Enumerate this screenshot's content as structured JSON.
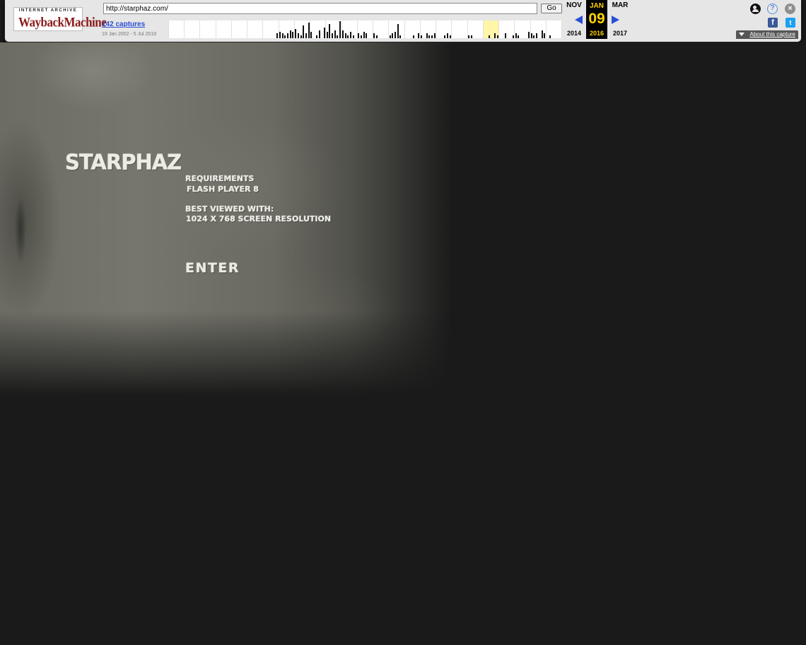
{
  "wayback": {
    "logo_top": "INTERNET ARCHIVE",
    "logo_bottom": "WaybackMachine",
    "url": "http://starphaz.com/",
    "go_label": "Go",
    "captures_label": "142 captures",
    "date_range": "19 Jan 2002 - 5 Jul 2019",
    "prev_month": "NOV",
    "prev_year": "2014",
    "current_month": "JAN",
    "current_day": "09",
    "current_year": "2016",
    "next_month": "MAR",
    "next_year": "2017",
    "about_label": "About this capture",
    "facebook_glyph": "f",
    "twitter_glyph": "t",
    "help_glyph": "?",
    "close_glyph": "×"
  },
  "sparkline": {
    "years": 18,
    "current_year_index": 20,
    "bars": [
      [
        6,
        2
      ],
      [
        6,
        3
      ],
      [
        7,
        2
      ],
      [
        7,
        4
      ],
      [
        8,
        3
      ],
      [
        9,
        2
      ],
      [
        10,
        3
      ],
      [
        11,
        5
      ],
      [
        12,
        4
      ],
      [
        13,
        6
      ],
      [
        14,
        3
      ],
      [
        15,
        2
      ],
      [
        16,
        8
      ],
      [
        17,
        3
      ],
      [
        18,
        10
      ],
      [
        19,
        4
      ],
      [
        21,
        2
      ],
      [
        22,
        5
      ],
      [
        24,
        7
      ],
      [
        25,
        4
      ],
      [
        26,
        9
      ],
      [
        27,
        3
      ],
      [
        28,
        5
      ],
      [
        29,
        2
      ],
      [
        30,
        11
      ],
      [
        31,
        5
      ],
      [
        32,
        3
      ],
      [
        33,
        2
      ],
      [
        34,
        4
      ],
      [
        35,
        2
      ],
      [
        37,
        3
      ],
      [
        38,
        2
      ],
      [
        39,
        4
      ],
      [
        40,
        3
      ],
      [
        43,
        3
      ],
      [
        44,
        2
      ],
      [
        49,
        2
      ],
      [
        50,
        3
      ],
      [
        51,
        4
      ],
      [
        52,
        9
      ],
      [
        53,
        2
      ],
      [
        58,
        2
      ],
      [
        60,
        3
      ],
      [
        61,
        2
      ],
      [
        63,
        3
      ],
      [
        64,
        2
      ],
      [
        65,
        2
      ],
      [
        66,
        3
      ],
      [
        70,
        2
      ],
      [
        71,
        3
      ],
      [
        72,
        2
      ],
      [
        79,
        2
      ],
      [
        80,
        2
      ],
      [
        87,
        2
      ],
      [
        89,
        3
      ],
      [
        90,
        2
      ],
      [
        93,
        3
      ],
      [
        96,
        2
      ],
      [
        97,
        3
      ],
      [
        98,
        2
      ],
      [
        102,
        4
      ],
      [
        103,
        3
      ],
      [
        104,
        2
      ],
      [
        105,
        3
      ],
      [
        107,
        5
      ],
      [
        108,
        3
      ],
      [
        110,
        2
      ]
    ]
  },
  "site": {
    "logo": "STARPHAZ",
    "requirements_heading": "REQUIREMENTS",
    "requirements_value": "FLASH PLAYER 8",
    "best_viewed_heading": "BEST VIEWED WITH:",
    "best_viewed_value": "1024 X 768  SCREEN RESOLUTION",
    "enter_label": "ENTER"
  },
  "colors": {
    "toolbar_bg": "#e6e6e6",
    "link_blue": "#2a4fd6",
    "current_highlight": "#ffd400",
    "page_bg": "#1a1a1a",
    "grunge_gray": "#6c6c64"
  }
}
